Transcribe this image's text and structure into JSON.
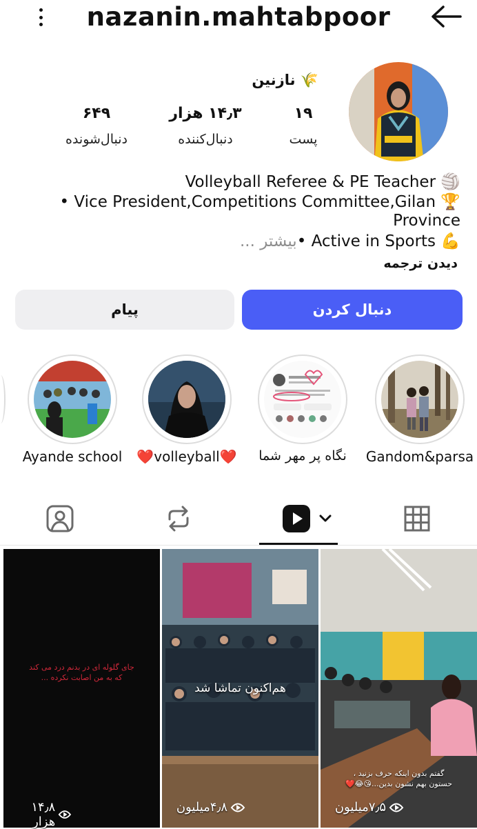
{
  "header": {
    "username": "nazanin.mahtabpoor"
  },
  "profile": {
    "display_name": "🌾 نازنین",
    "stats": [
      {
        "value": "۱۹",
        "label": "پست"
      },
      {
        "value": "۱۴٫۳ هزار",
        "label": "دنبال‌کننده"
      },
      {
        "value": "۶۴۹",
        "label": "دنبال‌شونده"
      }
    ],
    "bio_lines": [
      "Volleyball Referee & PE Teacher 🏐",
      "• Vice President,Competitions Committee,Gilan 🏆",
      "Province",
      "• Active in Sports 💪"
    ],
    "more": "... بیشتر",
    "translate": "دیدن ترجمه"
  },
  "actions": {
    "follow": "دنبال کردن",
    "message": "پیام"
  },
  "highlights": [
    {
      "label": "Ayande school"
    },
    {
      "label": "❤️volleyball❤️"
    },
    {
      "label": "نگاه پر مهر شما"
    },
    {
      "label": "Gandom&parsa"
    }
  ],
  "grid": [
    {
      "overlay": "جای گلوله ای در بدنم درد می کند\nکه به من اصابت نکرده ...",
      "views": "۱۴٫۸ هزار"
    },
    {
      "overlay": "هم‌اکنون تماشا شد",
      "views": "۴٫۸میلیون"
    },
    {
      "overlay": "گفتم بدون اینکه حرف بزنید ،\nحستون بهم نشون بدین...😘😂❤️",
      "views": "۷٫۵میلیون"
    }
  ],
  "colors": {
    "follow_button": "#4a5ef6",
    "message_button": "#efeff1"
  }
}
